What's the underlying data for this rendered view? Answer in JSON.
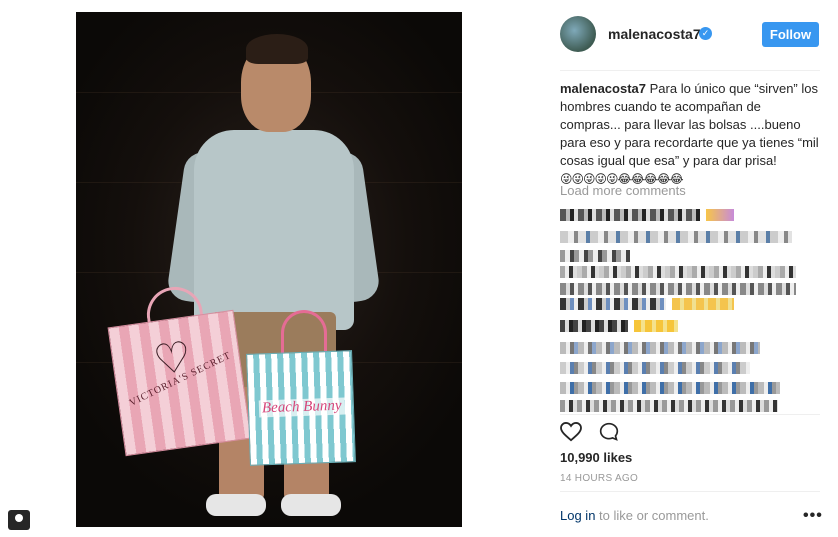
{
  "post": {
    "username": "malenacosta7",
    "verified_glyph": "✓",
    "follow_label": "Follow",
    "caption_user": "malenacosta7",
    "caption_text": "Para lo único que “sirven” los hombres cuando te acompañan de compras... para llevar las bolsas ....bueno para eso y para recordarte que ya tienes “mil cosas igual que esa” y para dar prisa!",
    "caption_emojis": "😜😜😜😜😜😂😂😂😂😂",
    "load_more": "Load more comments",
    "likes": "10,990 likes",
    "timestamp": "14 HOURS AGO",
    "login_link": "Log in",
    "login_rest": " to like or comment.",
    "more_options": "•••"
  },
  "photo": {
    "bag_pink_text": "VICTORIA'S SECRET",
    "bag_blue_text": "Beach Bunny"
  },
  "icons": {
    "verified": "verified-badge-icon",
    "like": "heart-icon",
    "comment": "comment-bubble-icon",
    "tagged": "tagged-user-icon"
  },
  "colors": {
    "accent": "#3897f0",
    "link": "#003569",
    "muted": "#999999"
  }
}
